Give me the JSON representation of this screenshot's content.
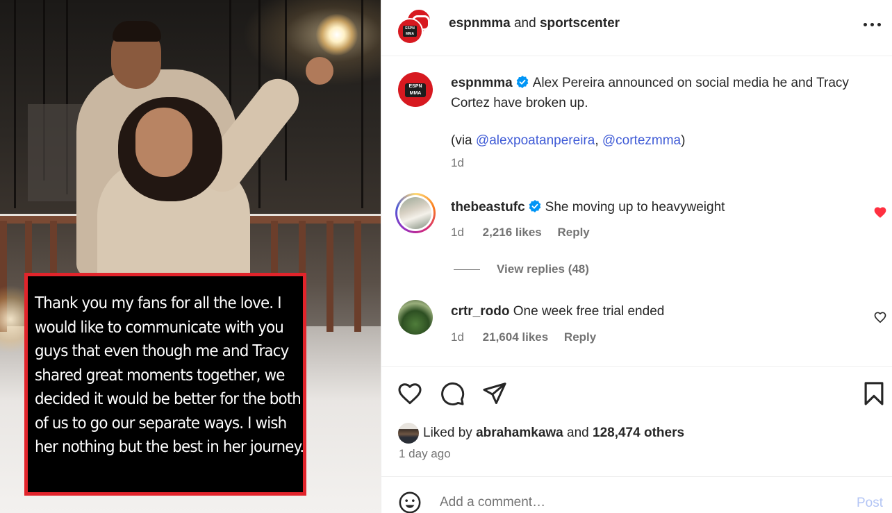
{
  "media": {
    "story_text": "Thank you my fans for all the love. I would like to communicate with you guys that even though me and Tracy shared great moments together, we decided it would be better for the both of us to go our separate ways. I wish her nothing but the best in her journey.",
    "border_color": "#e1242b"
  },
  "header": {
    "account_1": "espnmma",
    "joiner": "and",
    "account_2": "sportscenter",
    "more_icon": "more-horizontal-icon"
  },
  "caption": {
    "username": "espnmma",
    "text": "Alex Pereira announced on social media he and Tracy Cortez have broken up.",
    "via_prefix": "(via ",
    "mention_1": "@alexpoatanpereira",
    "separator": ", ",
    "mention_2": "@cortezmma",
    "via_suffix": ")",
    "time": "1d",
    "avatar_badge_top": "ESPN",
    "avatar_badge_bottom": "MMA"
  },
  "comments": [
    {
      "username": "thebeastufc",
      "text": "She moving up to heavyweight",
      "time": "1d",
      "likes": "2,216 likes",
      "reply": "Reply",
      "liked": true
    },
    {
      "username": "crtr_rodo",
      "text": "One week free trial ended",
      "time": "1d",
      "likes": "21,604 likes",
      "reply": "Reply",
      "liked": false
    }
  ],
  "view_replies": "View replies (48)",
  "likes": {
    "prefix": "Liked by",
    "user": "abrahamkawa",
    "joiner": "and",
    "others": "128,474 others"
  },
  "post_date": "1 day ago",
  "comment_box": {
    "placeholder": "Add a comment…",
    "post_label": "Post"
  },
  "colors": {
    "link": "#3f5bd6",
    "verified": "#0095f6",
    "like_red": "#ff3040",
    "post_disabled": "#b3c5f5"
  }
}
